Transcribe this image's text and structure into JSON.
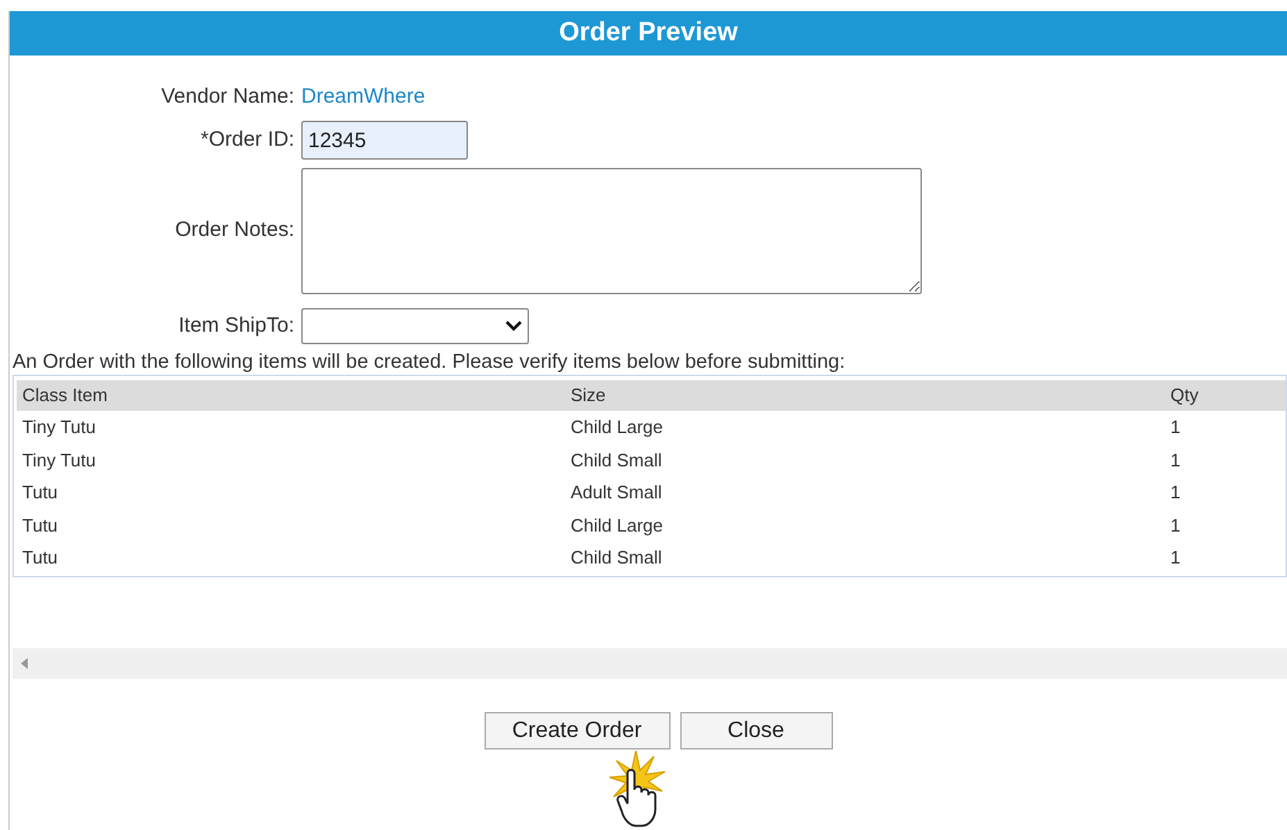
{
  "title": "Order Preview",
  "form": {
    "vendor_label": "Vendor Name:",
    "vendor_value": "DreamWhere",
    "order_id_label": "*Order ID:",
    "order_id_value": "12345",
    "notes_label": "Order Notes:",
    "shipto_label": "Item ShipTo:"
  },
  "message": "An Order with the following items will be created. Please verify items below before submitting:",
  "table": {
    "columns": [
      "Class Item",
      "Size",
      "Qty"
    ],
    "rows": [
      [
        "Tiny Tutu",
        "Child Large",
        "1"
      ],
      [
        "Tiny Tutu",
        "Child Small",
        "1"
      ],
      [
        "Tutu",
        "Adult Small",
        "1"
      ],
      [
        "Tutu",
        "Child Large",
        "1"
      ],
      [
        "Tutu",
        "Child Small",
        "1"
      ]
    ]
  },
  "buttons": [
    "Create Order",
    "Close"
  ]
}
